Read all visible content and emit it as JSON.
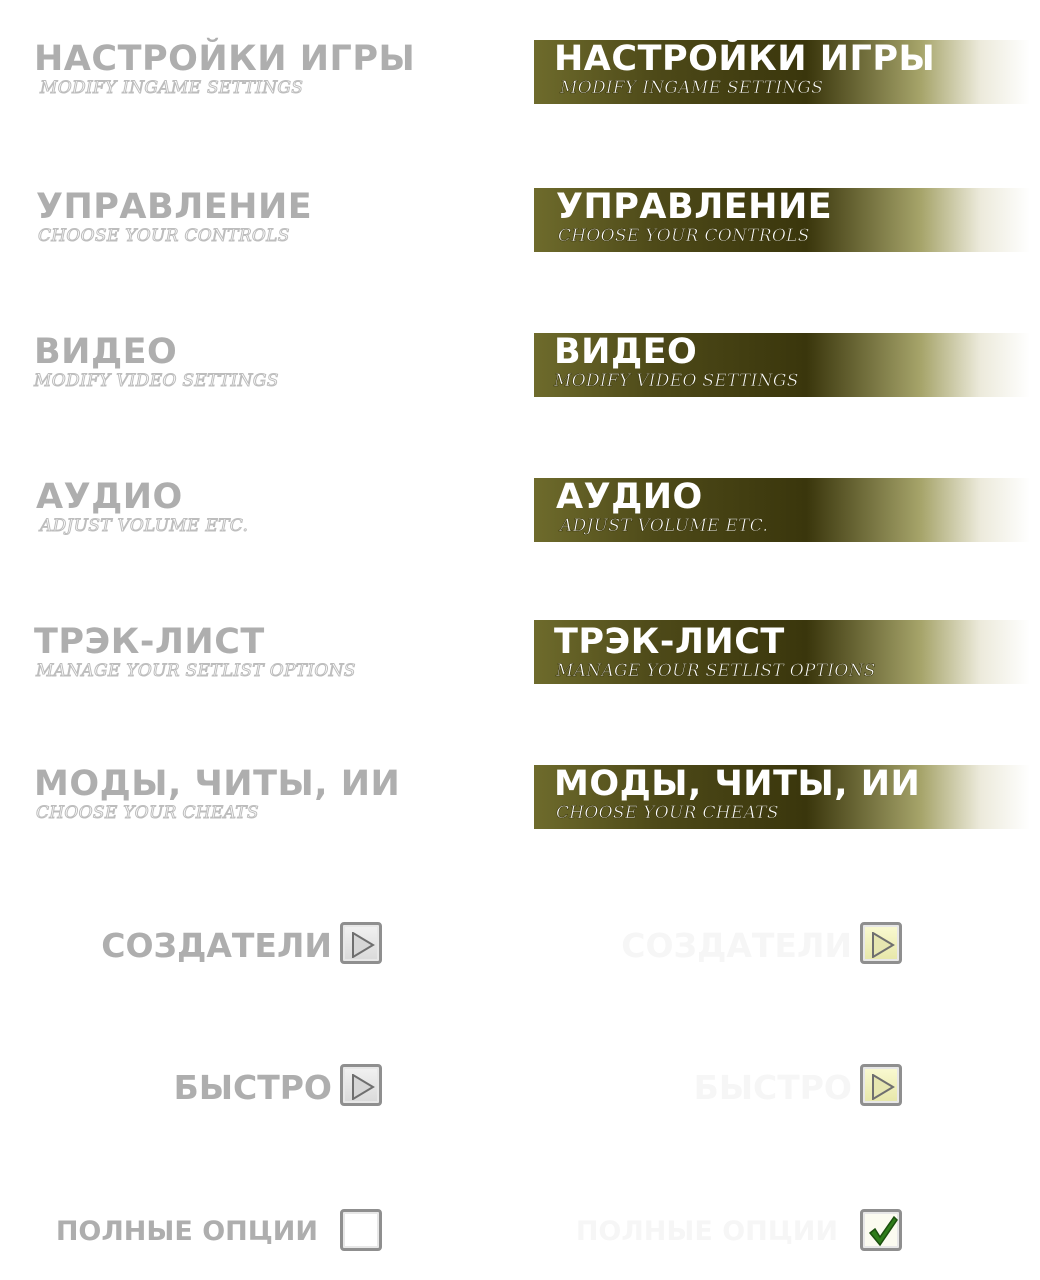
{
  "menu": [
    {
      "title": "НАСТРОЙКИ ИГРЫ",
      "subtitle": "MODIFY INGAME SETTINGS"
    },
    {
      "title": "УПРАВЛЕНИЕ",
      "subtitle": "CHOOSE YOUR CONTROLS"
    },
    {
      "title": "ВИДЕО",
      "subtitle": "MODIFY VIDEO SETTINGS"
    },
    {
      "title": "АУДИО",
      "subtitle": "ADJUST VOLUME  ETC."
    },
    {
      "title": "ТРЭК-ЛИСТ",
      "subtitle": "MANAGE YOUR SETLIST OPTIONS"
    },
    {
      "title": "МОДЫ, ЧИТЫ, ИИ",
      "subtitle": "CHOOSE YOUR CHEATS"
    }
  ],
  "buttons": {
    "credits_label": "СОЗДАТЕЛИ",
    "quick_label": "БЫСТРО",
    "full_options_label": "ПОЛНЫЕ ОПЦИИ",
    "full_options_checked_state": true
  },
  "colors": {
    "highlight_dark": "#3a360c",
    "normal_text": "#aeaeae",
    "check_mark": "#2e7d1a"
  },
  "icons": {
    "arrow": "play-arrow-icon",
    "check": "checkmark-icon"
  }
}
